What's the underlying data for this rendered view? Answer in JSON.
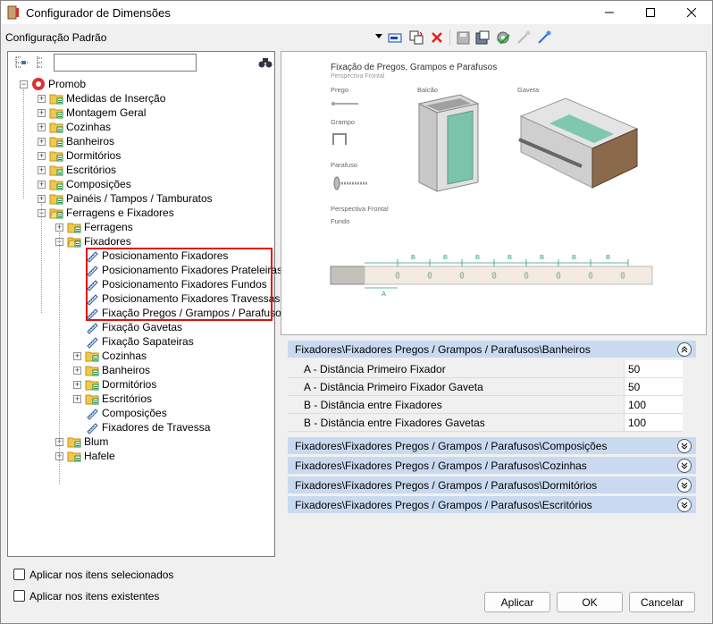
{
  "window": {
    "title": "Configurador de Dimensões"
  },
  "toolbar": {
    "config_name": "Configuração Padrão"
  },
  "tree": {
    "root": "Promob",
    "items": [
      {
        "label": "Medidas de Inserção"
      },
      {
        "label": "Montagem Geral"
      },
      {
        "label": "Cozinhas"
      },
      {
        "label": "Banheiros"
      },
      {
        "label": "Dormitórios"
      },
      {
        "label": "Escritórios"
      },
      {
        "label": "Composições"
      },
      {
        "label": "Painéis / Tampos / Tamburatos"
      },
      {
        "label": "Ferragens e Fixadores"
      },
      {
        "label": "Ferragens"
      },
      {
        "label": "Fixadores"
      },
      {
        "label": "Posicionamento Fixadores"
      },
      {
        "label": "Posicionamento Fixadores Prateleiras"
      },
      {
        "label": "Posicionamento Fixadores Fundos"
      },
      {
        "label": "Posicionamento Fixadores Travessas"
      },
      {
        "label": "Fixação Pregos / Grampos / Parafusos"
      },
      {
        "label": "Fixação Gavetas"
      },
      {
        "label": "Fixação Sapateiras"
      },
      {
        "label": "Cozinhas"
      },
      {
        "label": "Banheiros"
      },
      {
        "label": "Dormitórios"
      },
      {
        "label": "Escritórios"
      },
      {
        "label": "Composições"
      },
      {
        "label": "Fixadores de Travessa"
      },
      {
        "label": "Blum"
      },
      {
        "label": "Hafele"
      }
    ]
  },
  "preview": {
    "title": "Fixação de Pregos, Grampos e Parafusos",
    "subtitle": "Perspectiva Frontal",
    "prego": "Prego",
    "grampo": "Grampo",
    "parafuso": "Parafuso",
    "balcao": "Balcão",
    "gaveta": "Gaveta",
    "persp2": "Perspectiva Frontal",
    "fundo": "Fundo",
    "dim_a": "A",
    "dim_b": "B"
  },
  "groups": [
    {
      "header": "Fixadores\\Fixadores Pregos / Grampos / Parafusos\\Banheiros",
      "expanded": true,
      "rows": [
        {
          "key": "A - Distância Primeiro Fixador",
          "value": "50"
        },
        {
          "key": "A - Distância Primeiro Fixador Gaveta",
          "value": "50"
        },
        {
          "key": "B - Distância entre Fixadores",
          "value": "100"
        },
        {
          "key": "B - Distância entre Fixadores Gavetas",
          "value": "100"
        }
      ]
    },
    {
      "header": "Fixadores\\Fixadores Pregos / Grampos / Parafusos\\Composições",
      "expanded": false
    },
    {
      "header": "Fixadores\\Fixadores Pregos / Grampos / Parafusos\\Cozinhas",
      "expanded": false
    },
    {
      "header": "Fixadores\\Fixadores Pregos / Grampos / Parafusos\\Dormitórios",
      "expanded": false
    },
    {
      "header": "Fixadores\\Fixadores Pregos / Grampos / Parafusos\\Escritórios",
      "expanded": false
    }
  ],
  "options": {
    "apply_selected": "Aplicar nos itens selecionados",
    "apply_existing": "Aplicar nos itens existentes"
  },
  "buttons": {
    "apply": "Aplicar",
    "ok": "OK",
    "cancel": "Cancelar"
  }
}
